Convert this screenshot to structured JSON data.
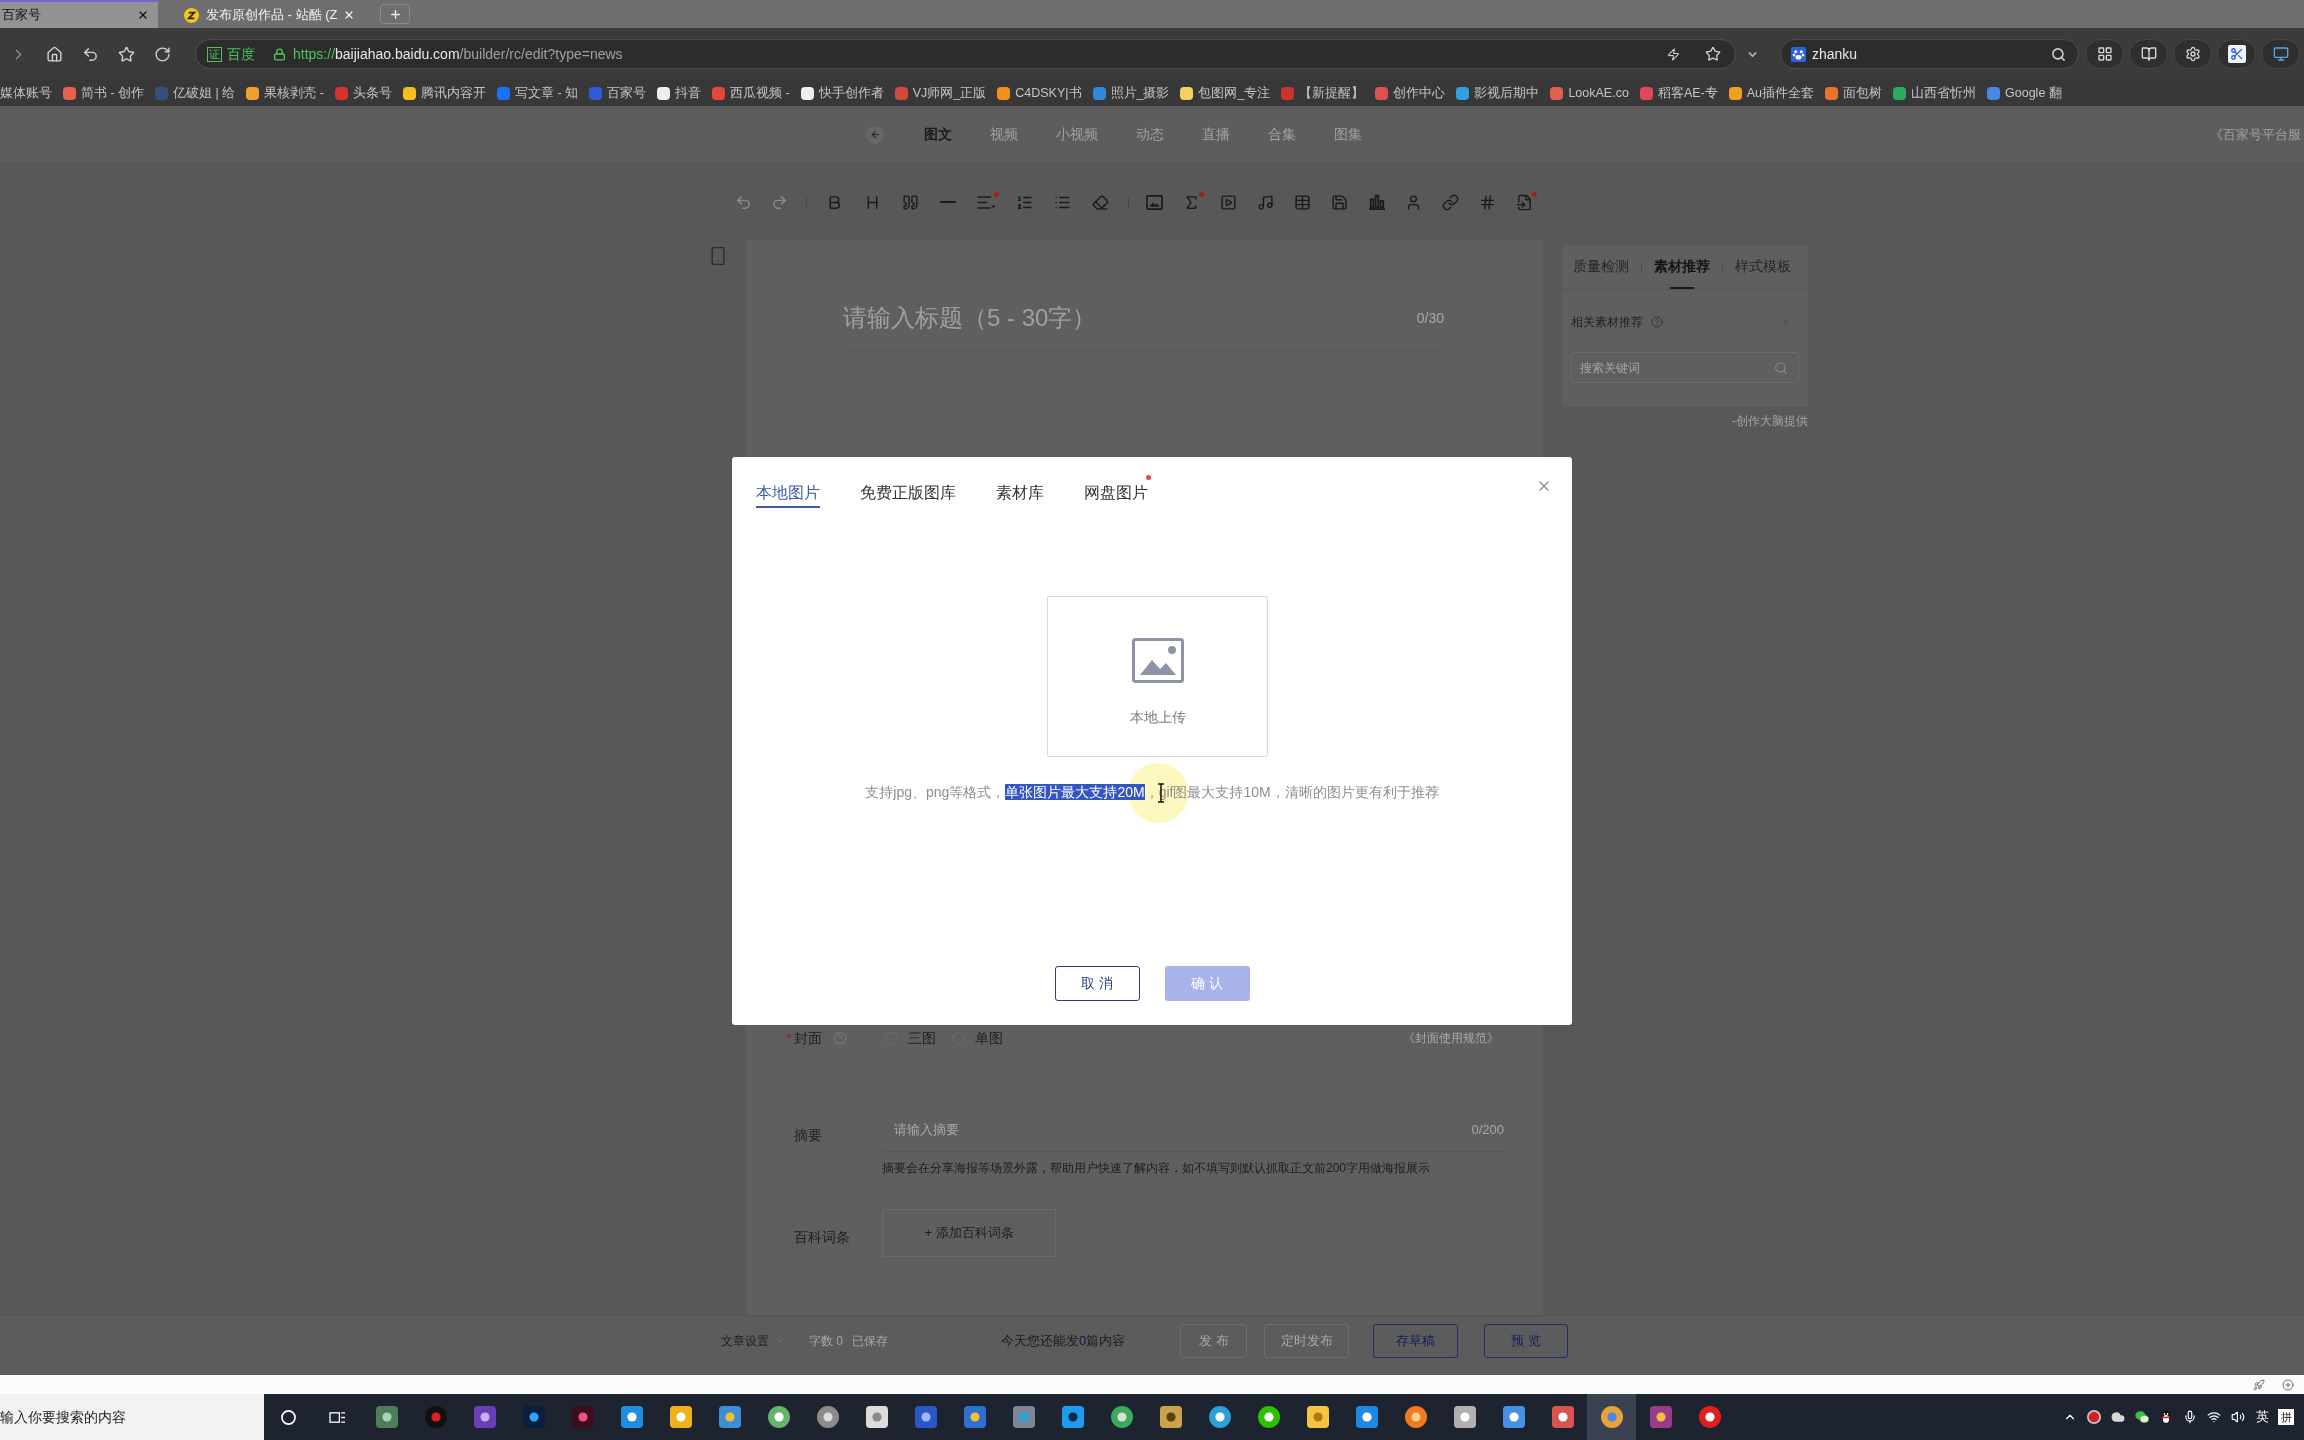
{
  "browser": {
    "tabs": [
      {
        "title": "百家号",
        "selected": true
      },
      {
        "title": "发布原创作品 - 站酷 (Z",
        "selected": false
      }
    ],
    "address_bar": {
      "badge": "证",
      "site": "百度",
      "url_scheme": "https://",
      "url_host": "baijiahao.baidu.com",
      "url_path": "/builder/rc/edit?type=news"
    },
    "search_box": {
      "value": "zhanku"
    },
    "bookmarks": [
      {
        "label": "媒体账号"
      },
      {
        "label": "简书 - 创作",
        "color": "#e7614d"
      },
      {
        "label": "亿破姐 | 给",
        "color": "#35507a"
      },
      {
        "label": "果核剥壳 -",
        "color": "#f0a030"
      },
      {
        "label": "头条号",
        "color": "#d6332b"
      },
      {
        "label": "腾讯内容开",
        "color": "#f4c020"
      },
      {
        "label": "写文章 - 知",
        "color": "#1673f5"
      },
      {
        "label": "百家号",
        "color": "#2e5ad6"
      },
      {
        "label": "抖音",
        "color": "#eeeeee"
      },
      {
        "label": "西瓜视频 -",
        "color": "#e8453c"
      },
      {
        "label": "快手创作者",
        "color": "#eeeeee"
      },
      {
        "label": "VJ师网_正版",
        "color": "#d24a3a"
      },
      {
        "label": "C4DSKY|书",
        "color": "#f0901e"
      },
      {
        "label": "照片_摄影",
        "color": "#2f8ad8"
      },
      {
        "label": "包图网_专注",
        "color": "#f4d060"
      },
      {
        "label": "【新提醒】",
        "color": "#c8352b"
      },
      {
        "label": "创作中心",
        "color": "#e05050"
      },
      {
        "label": "影视后期中",
        "color": "#30a0e0"
      },
      {
        "label": "LookAE.co",
        "color": "#e06050"
      },
      {
        "label": "稻客AE-专",
        "color": "#e0485a"
      },
      {
        "label": "Au插件全套",
        "color": "#f0a020"
      },
      {
        "label": "面包树",
        "color": "#e8762a"
      },
      {
        "label": "山西省忻州",
        "color": "#2fa860"
      },
      {
        "label": "Google 翻",
        "color": "#4a86e8"
      }
    ]
  },
  "page": {
    "nav": {
      "tabs": [
        {
          "label": "图文",
          "selected": true
        },
        {
          "label": "视频",
          "selected": false
        },
        {
          "label": "小视频",
          "selected": false
        },
        {
          "label": "动态",
          "selected": false
        },
        {
          "label": "直播",
          "selected": false
        },
        {
          "label": "合集",
          "selected": false
        },
        {
          "label": "图集",
          "selected": false
        }
      ],
      "policy_link": "《百家号平台服"
    },
    "toolbar": [
      {
        "disabled": true,
        "dot": false
      },
      {
        "disabled": true,
        "dot": false
      },
      {
        "disabled": false,
        "dot": false
      },
      {
        "disabled": false,
        "dot": false
      },
      {
        "disabled": false,
        "dot": false
      },
      {
        "disabled": false,
        "dot": false
      },
      {
        "disabled": false,
        "dot": true
      },
      {
        "disabled": false,
        "dot": false
      },
      {
        "disabled": false,
        "dot": false
      },
      {
        "disabled": false,
        "dot": false
      },
      {
        "disabled": false,
        "dot": false
      },
      {
        "disabled": false,
        "dot": true
      },
      {
        "disabled": false,
        "dot": false
      },
      {
        "disabled": false,
        "dot": false
      },
      {
        "disabled": false,
        "dot": false
      },
      {
        "disabled": false,
        "dot": false
      },
      {
        "disabled": false,
        "dot": false
      },
      {
        "disabled": false,
        "dot": false
      },
      {
        "disabled": false,
        "dot": false
      },
      {
        "disabled": false,
        "dot": false
      },
      {
        "disabled": false,
        "dot": true
      }
    ],
    "editor": {
      "title_placeholder": "请输入标题（5 - 30字）",
      "title_count": "0/30",
      "cover": {
        "required_mark": "*",
        "label": "封面",
        "options": [
          {
            "label": "三图",
            "selected": false
          },
          {
            "label": "单图",
            "selected": false
          }
        ],
        "rules_link": "《封面使用规范》"
      },
      "summary": {
        "label": "摘要",
        "placeholder": "请输入摘要",
        "count": "0/200",
        "hint": "摘要会在分享海报等场景外露，帮助用户快速了解内容，如不填写则默认抓取正文前200字用做海报展示"
      },
      "wiki": {
        "label": "百科词条",
        "button": "+ 添加百科词条"
      }
    },
    "side_panel": {
      "tabs": [
        {
          "label": "质量检测",
          "selected": false
        },
        {
          "label": "素材推荐",
          "selected": true
        },
        {
          "label": "样式模板",
          "selected": false
        }
      ],
      "section_title": "相关素材推荐",
      "search_placeholder": "搜索关键词",
      "credit": "-创作大脑提供"
    },
    "footer": {
      "settings": "文章设置",
      "word_count": "字数 0",
      "save_status": "已保存",
      "quota": {
        "before": "今天您还能发",
        "count": "0",
        "after": "篇内容"
      },
      "buttons": [
        {
          "label": "发 布",
          "disabled": true
        },
        {
          "label": "定时发布",
          "disabled": true
        },
        {
          "label": "存草稿",
          "disabled": false
        },
        {
          "label": "预 览",
          "disabled": false
        }
      ]
    }
  },
  "dialog": {
    "tabs": [
      {
        "label": "本地图片",
        "selected": true,
        "dot": false
      },
      {
        "label": "免费正版图库",
        "selected": false,
        "dot": false
      },
      {
        "label": "素材库",
        "selected": false,
        "dot": false
      },
      {
        "label": "网盘图片",
        "selected": false,
        "dot": true
      }
    ],
    "upload_label": "本地上传",
    "hint": [
      {
        "text": "支持jpg、png等格式，",
        "highlighted": false
      },
      {
        "text": "单张图片最大支持20M",
        "highlighted": true
      },
      {
        "text": "，gif图最大支持10M，清晰的图片更有利于推荐",
        "highlighted": false
      }
    ],
    "buttons": [
      {
        "label": "取 消",
        "kind": "secondary",
        "disabled": false
      },
      {
        "label": "确 认",
        "kind": "primary",
        "disabled": true
      }
    ]
  },
  "taskbar": {
    "search_placeholder": "输入你要搜索的内容",
    "apps": [
      {
        "selected": false
      },
      {
        "selected": false
      },
      {
        "selected": false
      },
      {
        "selected": false
      },
      {
        "selected": false
      },
      {
        "selected": false
      },
      {
        "selected": false
      },
      {
        "selected": false
      },
      {
        "selected": false
      },
      {
        "selected": false
      },
      {
        "selected": false
      },
      {
        "selected": false
      },
      {
        "selected": false
      },
      {
        "selected": false
      },
      {
        "selected": false
      },
      {
        "selected": false
      },
      {
        "selected": false
      },
      {
        "selected": false
      },
      {
        "selected": false
      },
      {
        "selected": false
      },
      {
        "selected": false
      },
      {
        "selected": false
      },
      {
        "selected": false
      },
      {
        "selected": false
      },
      {
        "selected": false
      },
      {
        "selected": true
      },
      {
        "selected": false
      },
      {
        "selected": false
      }
    ],
    "input_method": "英",
    "input_mode": "拼"
  }
}
